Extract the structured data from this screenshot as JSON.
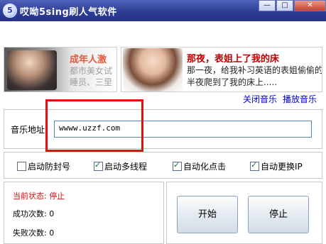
{
  "window": {
    "title": "哎呦5sing刷人气软件",
    "app_icon_glyph": "5",
    "controls": {
      "minimize": "—",
      "maximize": "□",
      "close": "✕"
    }
  },
  "ads": {
    "left": {
      "title": "成年人激",
      "line1": "都市美女试",
      "line2": "睡员、三里"
    },
    "right": {
      "title": "那夜，表姐上了我的床",
      "line1": "那一夜，给我补习英语的表姐偷偷的",
      "line2": "半夜爬到了我的床上....."
    },
    "links": {
      "close_music": "关闭音乐",
      "play_music": "播放音乐"
    }
  },
  "music_url": {
    "label": "音乐地址:",
    "value": "wwww.uzzf.com"
  },
  "options": [
    {
      "label": "启动防封号",
      "checked": false
    },
    {
      "label": "启动多线程",
      "checked": true
    },
    {
      "label": "自动化点击",
      "checked": true
    },
    {
      "label": "自动更换IP",
      "checked": true
    }
  ],
  "status": {
    "current": "当前状态: 停止",
    "success": "成功次数: 0",
    "fail": "失败次数: 0"
  },
  "buttons": {
    "start": "开始",
    "stop": "停止"
  },
  "colors": {
    "title_bar": "#2c3c92",
    "highlight_box": "#e01010",
    "status_text": "#d01010",
    "link": "#0000cc"
  }
}
